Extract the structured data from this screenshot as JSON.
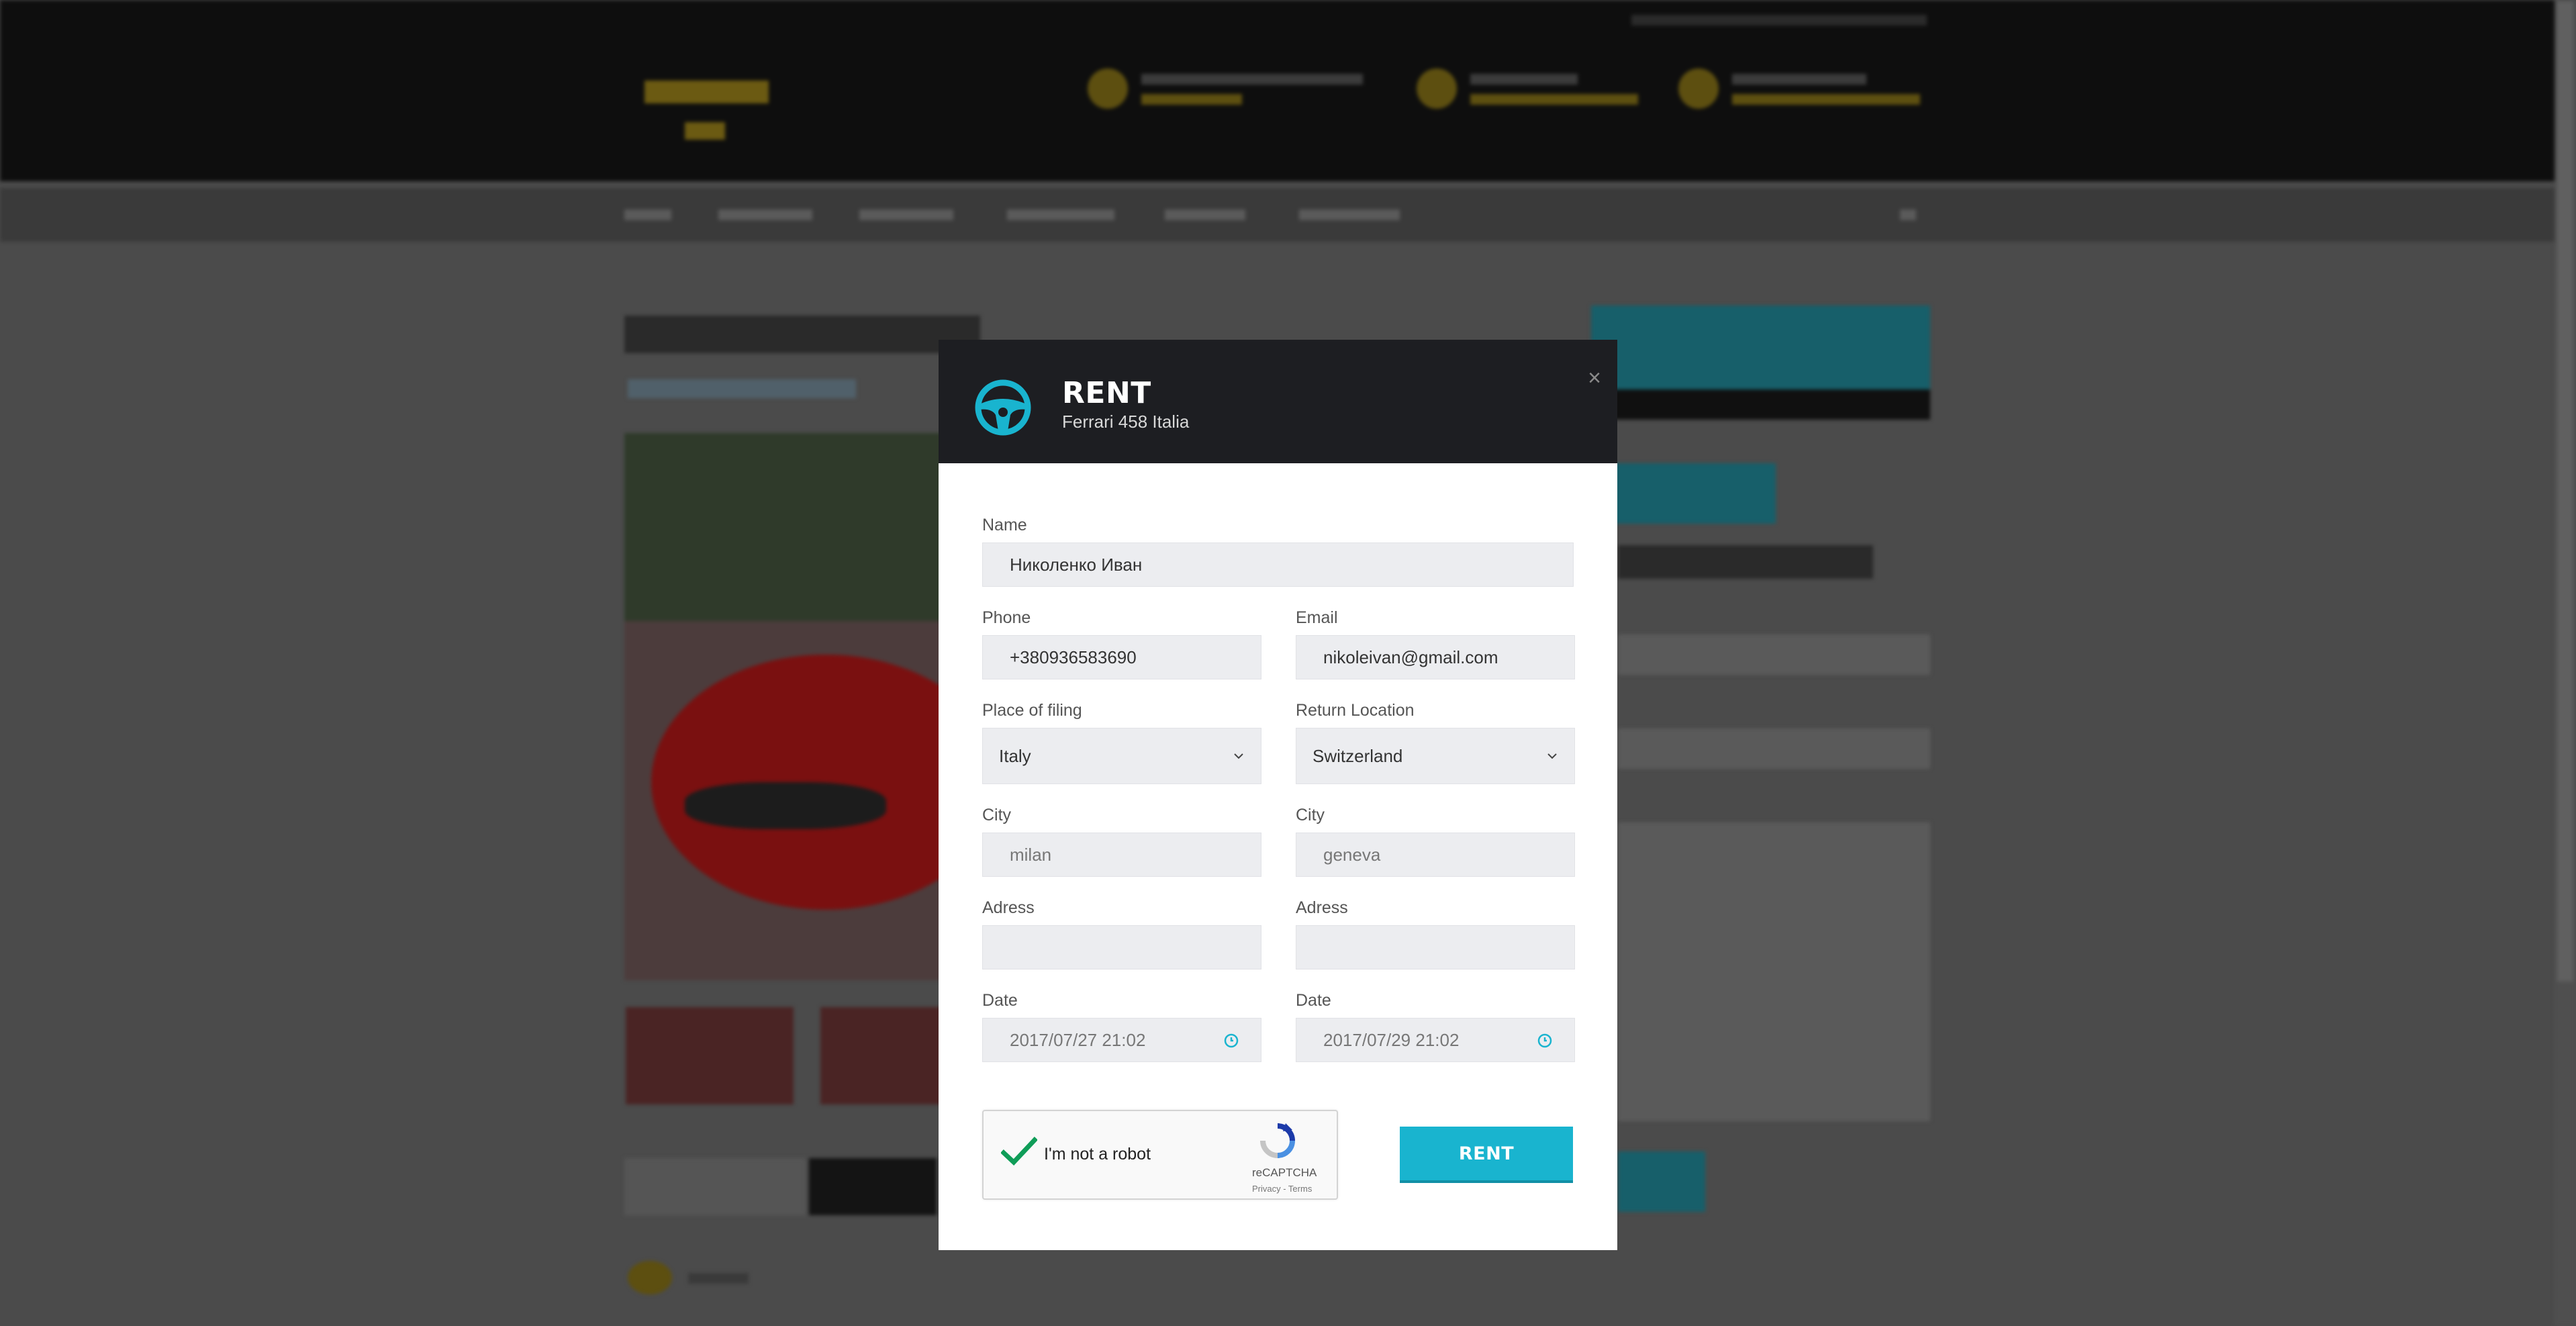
{
  "modal": {
    "title": "RENT",
    "subtitle": "Ferrari 458 Italia",
    "close_label": "×",
    "accent_color": "#19b4cf",
    "header_color": "#1d1e22",
    "icon": "steering-wheel-icon"
  },
  "form": {
    "name": {
      "label": "Name",
      "value": "Николенко Иван"
    },
    "phone": {
      "label": "Phone",
      "value": "+380936583690"
    },
    "email": {
      "label": "Email",
      "value": "nikoleivan@gmail.com"
    },
    "place_of_filing": {
      "label": "Place of filing",
      "value": "Italy"
    },
    "return_location": {
      "label": "Return Location",
      "value": "Switzerland"
    },
    "city_from": {
      "label": "City",
      "value": "milan"
    },
    "city_to": {
      "label": "City",
      "value": "geneva"
    },
    "address_from": {
      "label": "Adress",
      "value": ""
    },
    "address_to": {
      "label": "Adress",
      "value": ""
    },
    "date_from": {
      "label": "Date",
      "value": "2017/07/27 21:02"
    },
    "date_to": {
      "label": "Date",
      "value": "2017/07/29 21:02"
    }
  },
  "captcha": {
    "text": "I'm not a robot",
    "brand": "reCAPTCHA",
    "links": "Privacy - Terms",
    "checked": true
  },
  "submit": {
    "label": "RENT"
  }
}
